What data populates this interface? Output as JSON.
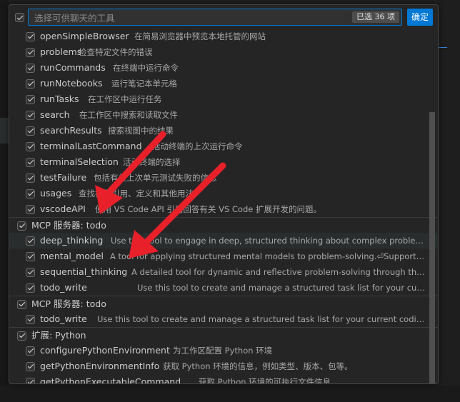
{
  "search": {
    "placeholder": "选择可供聊天的工具",
    "selected_badge": "已选 36 项"
  },
  "ok_button": "确定",
  "items": [
    {
      "type": "tool",
      "name": "openSimpleBrowser",
      "desc": "在简易浏览器中预览本地托管的网站"
    },
    {
      "type": "tool",
      "name": "problems",
      "desc": "检查特定文件的错误"
    },
    {
      "type": "tool",
      "name": "runCommands",
      "desc": "在终端中运行命令"
    },
    {
      "type": "tool",
      "name": "runNotebooks",
      "desc": "运行笔记本单元格"
    },
    {
      "type": "tool",
      "name": "runTasks",
      "desc": "在工作区中运行任务"
    },
    {
      "type": "tool",
      "name": "search",
      "desc": "在工作区中搜索和读取文件"
    },
    {
      "type": "tool",
      "name": "searchResults",
      "desc": "搜索视图中的结果"
    },
    {
      "type": "tool",
      "name": "terminalLastCommand",
      "desc": "活动终端的上次运行命令"
    },
    {
      "type": "tool",
      "name": "terminalSelection",
      "desc": "活动终端的选择"
    },
    {
      "type": "tool",
      "name": "testFailure",
      "desc": "包括有关上次单元测试失败的信息"
    },
    {
      "type": "tool",
      "name": "usages",
      "desc": "查找符号引用、定义和其他用法"
    },
    {
      "type": "tool",
      "name": "vscodeAPI",
      "desc": "使用 VS Code API 引用回答有关 VS Code 扩展开发的问题。"
    },
    {
      "type": "group",
      "name": "MCP 服务器: todo",
      "desc": ""
    },
    {
      "type": "tool",
      "name": "deep_thinking",
      "desc": "Use this tool to engage in deep, structured thinking about complex problems, user r..."
    },
    {
      "type": "tool",
      "name": "mental_model",
      "desc": "A tool for applying structured mental models to problem-solving.⏎Supports various..."
    },
    {
      "type": "tool",
      "name": "sequential_thinking",
      "desc": "A detailed tool for dynamic and reflective problem-solving through thoughts...."
    },
    {
      "type": "tool",
      "name": "todo_write",
      "desc": "Use this tool to create and manage a structured task list for your current codi..."
    },
    {
      "type": "group",
      "name": "MCP 服务器: todo",
      "desc": ""
    },
    {
      "type": "tool",
      "name": "todo_write",
      "desc": "Use this tool to create and manage a structured task list for your current coding session. ..."
    },
    {
      "type": "group",
      "name": "扩展: Python",
      "desc": ""
    },
    {
      "type": "tool",
      "name": "configurePythonEnvironment",
      "desc": "为工作区配置 Python 环境"
    },
    {
      "type": "tool",
      "name": "getPythonEnvironmentInfo",
      "desc": "获取 Python 环境的信息，例如类型、版本、包等。"
    },
    {
      "type": "tool",
      "name": "getPythonExecutableCommand",
      "desc": "获取 Python 环境的可执行文件信息"
    }
  ],
  "colors": {
    "accent": "#0078d4",
    "annotation_arrow": "#e8202a",
    "panel_bg": "#252526"
  }
}
